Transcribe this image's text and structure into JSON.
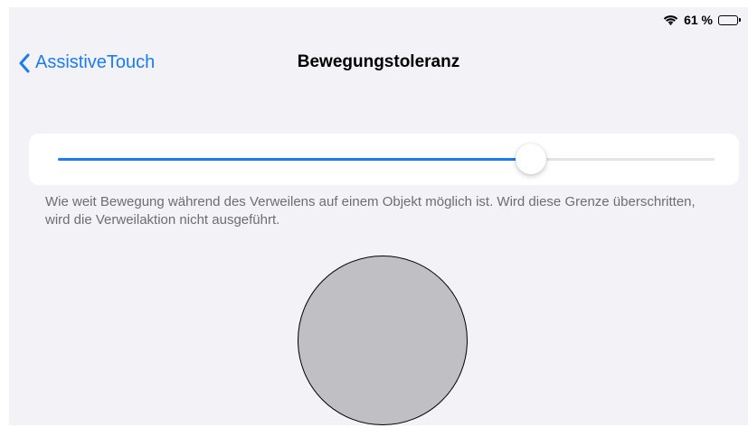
{
  "status_bar": {
    "battery_percent": "61 %",
    "battery_level": 0.61,
    "wifi_icon": "wifi-icon",
    "battery_icon": "battery-icon"
  },
  "nav": {
    "back_label": "AssistiveTouch",
    "back_icon": "chevron-left-icon",
    "title": "Bewegungstoleranz"
  },
  "slider": {
    "value": 0.72
  },
  "footer": {
    "text": "Wie weit Bewegung während des Verweilens auf einem Objekt möglich ist. Wird diese Grenze überschritten, wird die Verweilaktion nicht ausgeführt."
  },
  "colors": {
    "accent": "#1a7cf5",
    "background": "#f2f2f7",
    "circle_fill": "#c0bfc4"
  }
}
